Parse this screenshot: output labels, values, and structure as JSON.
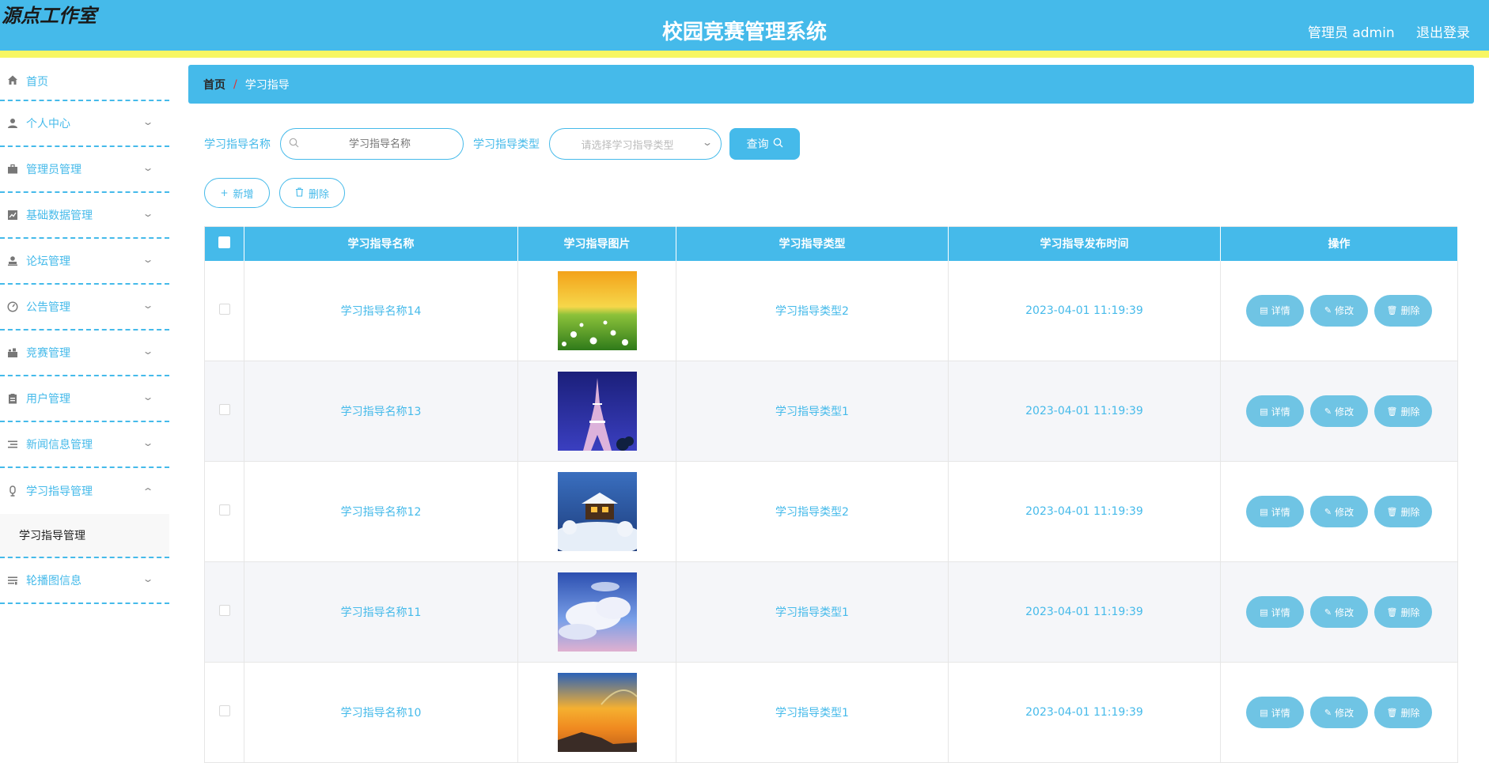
{
  "header": {
    "brand": "源点工作室",
    "title": "校园竞赛管理系统",
    "user": "管理员 admin",
    "logout": "退出登录"
  },
  "sidebar": {
    "items": [
      {
        "label": "首页",
        "icon": "home-icon"
      },
      {
        "label": "个人中心",
        "icon": "user-icon"
      },
      {
        "label": "管理员管理",
        "icon": "briefcase-icon"
      },
      {
        "label": "基础数据管理",
        "icon": "chart-icon"
      },
      {
        "label": "论坛管理",
        "icon": "forum-icon"
      },
      {
        "label": "公告管理",
        "icon": "gauge-icon"
      },
      {
        "label": "竞赛管理",
        "icon": "trophy-icon"
      },
      {
        "label": "用户管理",
        "icon": "clipboard-icon"
      },
      {
        "label": "新闻信息管理",
        "icon": "list-icon"
      },
      {
        "label": "学习指导管理",
        "icon": "mic-icon"
      },
      {
        "label": "轮播图信息",
        "icon": "sliders-icon"
      }
    ],
    "submenu_item": "学习指导管理"
  },
  "breadcrumb": {
    "home": "首页",
    "separator": "/",
    "current": "学习指导"
  },
  "search": {
    "name_label": "学习指导名称",
    "name_placeholder": "学习指导名称",
    "type_label": "学习指导类型",
    "type_placeholder": "请选择学习指导类型",
    "query_label": "查询"
  },
  "actions": {
    "add_label": "新增",
    "delete_label": "删除"
  },
  "table": {
    "columns": [
      "学习指导名称",
      "学习指导图片",
      "学习指导类型",
      "学习指导发布时间",
      "操作"
    ],
    "ops": {
      "detail": "详情",
      "edit": "修改",
      "delete": "删除"
    },
    "rows": [
      {
        "name": "学习指导名称14",
        "type": "学习指导类型2",
        "time": "2023-04-01 11:19:39",
        "image": "flower-meadow"
      },
      {
        "name": "学习指导名称13",
        "type": "学习指导类型1",
        "time": "2023-04-01 11:19:39",
        "image": "eiffel-tower"
      },
      {
        "name": "学习指导名称12",
        "type": "学习指导类型2",
        "time": "2023-04-01 11:19:39",
        "image": "snow-cabin"
      },
      {
        "name": "学习指导名称11",
        "type": "学习指导类型1",
        "time": "2023-04-01 11:19:39",
        "image": "clouds-sky"
      },
      {
        "name": "学习指导名称10",
        "type": "学习指导类型1",
        "time": "2023-04-01 11:19:39",
        "image": "sunset-sea"
      }
    ]
  },
  "colors": {
    "primary": "#45baea",
    "accent_bar": "#f7f663",
    "op_button": "#6fc4e4"
  }
}
